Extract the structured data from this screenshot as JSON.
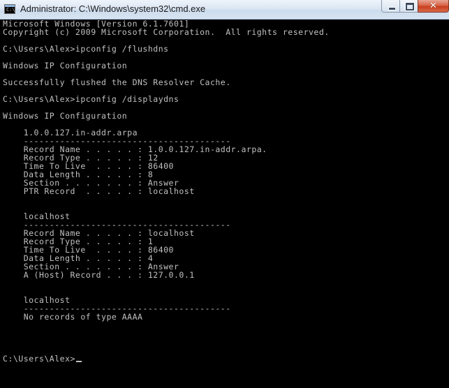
{
  "window": {
    "title": "Administrator: C:\\Windows\\system32\\cmd.exe",
    "icon": "cmd-icon",
    "controls": {
      "minimize": "minimize-icon",
      "maximize": "maximize-icon",
      "close": "close-icon",
      "close_glyph": "✕"
    }
  },
  "console": {
    "lines": [
      "Microsoft Windows [Version 6.1.7601]",
      "Copyright (c) 2009 Microsoft Corporation.  All rights reserved.",
      "",
      "C:\\Users\\Alex>ipconfig /flushdns",
      "",
      "Windows IP Configuration",
      "",
      "Successfully flushed the DNS Resolver Cache.",
      "",
      "C:\\Users\\Alex>ipconfig /displaydns",
      "",
      "Windows IP Configuration",
      "",
      "    1.0.0.127.in-addr.arpa",
      "    ----------------------------------------",
      "    Record Name . . . . . : 1.0.0.127.in-addr.arpa.",
      "    Record Type . . . . . : 12",
      "    Time To Live  . . . . : 86400",
      "    Data Length . . . . . : 8",
      "    Section . . . . . . . : Answer",
      "    PTR Record  . . . . . : localhost",
      "",
      "",
      "    localhost",
      "    ----------------------------------------",
      "    Record Name . . . . . : localhost",
      "    Record Type . . . . . : 1",
      "    Time To Live  . . . . : 86400",
      "    Data Length . . . . . : 4",
      "    Section . . . . . . . : Answer",
      "    A (Host) Record . . . : 127.0.0.1",
      "",
      "",
      "    localhost",
      "    ----------------------------------------",
      "    No records of type AAAA",
      "",
      "",
      "",
      ""
    ],
    "prompt": "C:\\Users\\Alex>"
  },
  "colors": {
    "background": "#000000",
    "text": "#c0c0c0"
  }
}
